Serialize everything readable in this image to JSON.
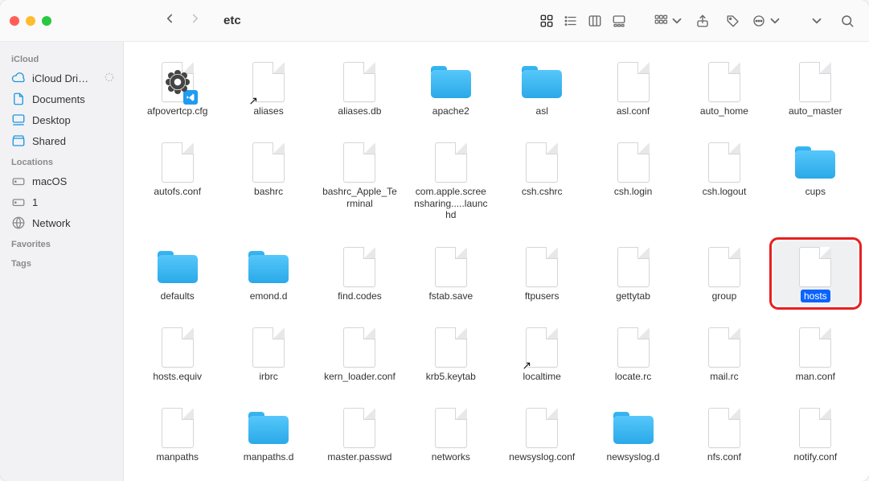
{
  "window": {
    "title": "etc"
  },
  "sidebar": {
    "sections": [
      {
        "title": "iCloud",
        "items": [
          {
            "id": "icloud-drive",
            "label": "iCloud Dri…",
            "icon": "cloud",
            "trailing": "progress"
          },
          {
            "id": "documents",
            "label": "Documents",
            "icon": "doc"
          },
          {
            "id": "desktop",
            "label": "Desktop",
            "icon": "desktop"
          },
          {
            "id": "shared",
            "label": "Shared",
            "icon": "shared"
          }
        ]
      },
      {
        "title": "Locations",
        "items": [
          {
            "id": "macos",
            "label": "macOS",
            "icon": "hdd",
            "gray": true
          },
          {
            "id": "one",
            "label": "1",
            "icon": "hdd",
            "gray": true
          },
          {
            "id": "network",
            "label": "Network",
            "icon": "globe",
            "gray": true
          }
        ]
      },
      {
        "title": "Favorites",
        "items": []
      },
      {
        "title": "Tags",
        "items": []
      }
    ]
  },
  "contents": [
    {
      "name": "afpovertcp.cfg",
      "type": "file-gear-vscode"
    },
    {
      "name": "aliases",
      "type": "file",
      "alias": true
    },
    {
      "name": "aliases.db",
      "type": "file"
    },
    {
      "name": "apache2",
      "type": "folder"
    },
    {
      "name": "asl",
      "type": "folder"
    },
    {
      "name": "asl.conf",
      "type": "file"
    },
    {
      "name": "auto_home",
      "type": "file"
    },
    {
      "name": "auto_master",
      "type": "file"
    },
    {
      "name": "autofs.conf",
      "type": "file"
    },
    {
      "name": "bashrc",
      "type": "file"
    },
    {
      "name": "bashrc_Apple_Terminal",
      "type": "file"
    },
    {
      "name": "com.apple.screensharing.....launchd",
      "type": "file"
    },
    {
      "name": "csh.cshrc",
      "type": "file"
    },
    {
      "name": "csh.login",
      "type": "file"
    },
    {
      "name": "csh.logout",
      "type": "file"
    },
    {
      "name": "cups",
      "type": "folder"
    },
    {
      "name": "defaults",
      "type": "folder"
    },
    {
      "name": "emond.d",
      "type": "folder"
    },
    {
      "name": "find.codes",
      "type": "file"
    },
    {
      "name": "fstab.save",
      "type": "file"
    },
    {
      "name": "ftpusers",
      "type": "file"
    },
    {
      "name": "gettytab",
      "type": "file"
    },
    {
      "name": "group",
      "type": "file"
    },
    {
      "name": "hosts",
      "type": "file",
      "selected": true,
      "highlight": true
    },
    {
      "name": "hosts.equiv",
      "type": "file"
    },
    {
      "name": "irbrc",
      "type": "file"
    },
    {
      "name": "kern_loader.conf",
      "type": "file"
    },
    {
      "name": "krb5.keytab",
      "type": "file"
    },
    {
      "name": "localtime",
      "type": "file",
      "alias": true
    },
    {
      "name": "locate.rc",
      "type": "file"
    },
    {
      "name": "mail.rc",
      "type": "file"
    },
    {
      "name": "man.conf",
      "type": "file"
    },
    {
      "name": "manpaths",
      "type": "file"
    },
    {
      "name": "manpaths.d",
      "type": "folder"
    },
    {
      "name": "master.passwd",
      "type": "file"
    },
    {
      "name": "networks",
      "type": "file"
    },
    {
      "name": "newsyslog.conf",
      "type": "file"
    },
    {
      "name": "newsyslog.d",
      "type": "folder"
    },
    {
      "name": "nfs.conf",
      "type": "file"
    },
    {
      "name": "notify.conf",
      "type": "file"
    }
  ]
}
